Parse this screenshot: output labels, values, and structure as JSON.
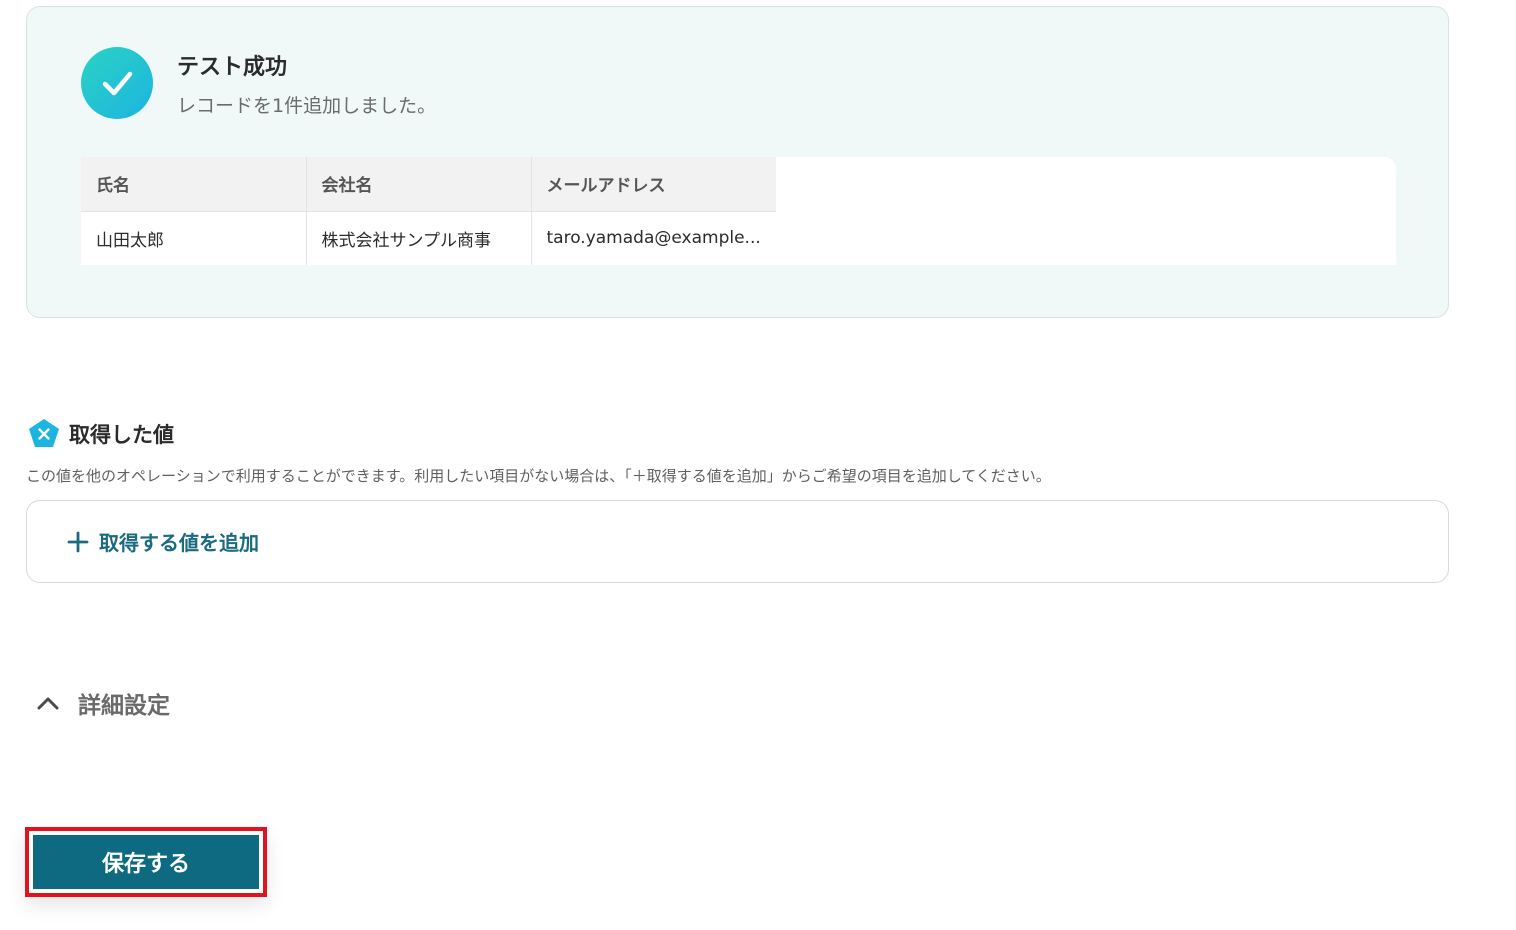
{
  "success": {
    "title": "テスト成功",
    "subtitle": "レコードを1件追加しました。"
  },
  "table": {
    "headers": [
      "氏名",
      "会社名",
      "メールアドレス"
    ],
    "rows": [
      [
        "山田太郎",
        "株式会社サンプル商事",
        "taro.yamada@example..."
      ]
    ]
  },
  "acquired": {
    "title": "取得した値",
    "description": "この値を他のオペレーションで利用することができます。利用したい項目がない場合は、「＋取得する値を追加」からご希望の項目を追加してください。",
    "add_label": "取得する値を追加"
  },
  "advanced": {
    "label": "詳細設定"
  },
  "save": {
    "label": "保存する"
  },
  "icons": {
    "success": "check-icon",
    "acquired": "variable-pentagon-icon",
    "add": "plus-icon",
    "advanced": "chevron-up-icon"
  },
  "colors": {
    "accent": "#0e6a80",
    "success_gradient_start": "#2ad3c3",
    "success_gradient_end": "#1cb4e0",
    "highlight_border": "#e0141e"
  }
}
